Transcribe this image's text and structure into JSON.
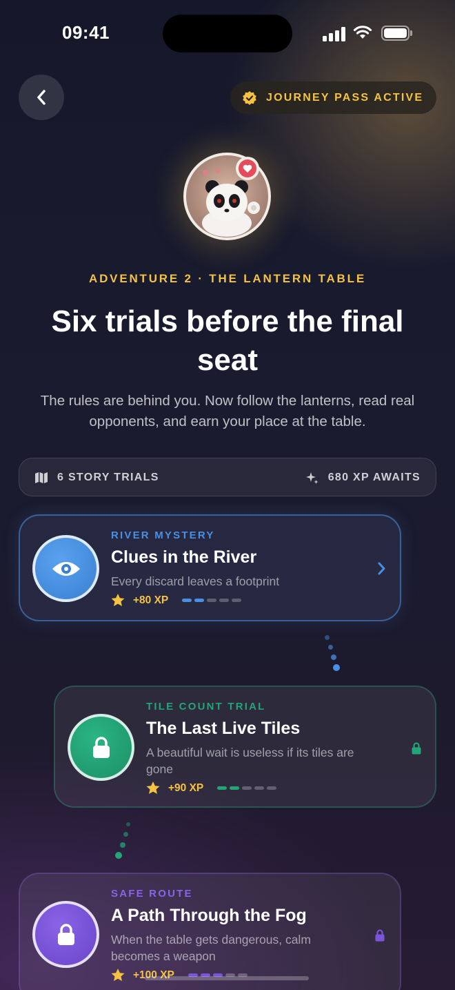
{
  "status": {
    "time": "09:41"
  },
  "header": {
    "back_icon": "chevron-left-icon",
    "pass_label": "JOURNEY PASS ACTIVE",
    "pass_icon": "verified-badge-icon"
  },
  "hero": {
    "eyebrow": "ADVENTURE 2 · THE LANTERN TABLE",
    "title": "Six trials before the final seat",
    "subtitle": "The rules are behind you. Now follow the lanterns, read real opponents, and earn your place at the table."
  },
  "stats": {
    "trials_label": "6 STORY TRIALS",
    "xp_label": "680 XP AWAITS"
  },
  "trials": [
    {
      "kicker": "RIVER MYSTERY",
      "title": "Clues in the River",
      "desc": "Every discard leaves a footprint",
      "xp": "+80 XP",
      "icon": "eye-icon",
      "state": "open",
      "accent": "#4a90e2",
      "progress": 2,
      "steps": 5
    },
    {
      "kicker": "TILE COUNT TRIAL",
      "title": "The Last Live Tiles",
      "desc": "A beautiful wait is useless if its tiles are gone",
      "xp": "+90 XP",
      "icon": "lock-icon",
      "state": "locked",
      "accent": "#22a577",
      "progress": 2,
      "steps": 5
    },
    {
      "kicker": "SAFE ROUTE",
      "title": "A Path Through the Fog",
      "desc": "When the table gets dangerous, calm becomes a weapon",
      "xp": "+100 XP",
      "icon": "lock-icon",
      "state": "locked",
      "accent": "#7b55d8",
      "progress": 3,
      "steps": 5
    }
  ],
  "colors": {
    "gold": "#f5c242",
    "blue": "#4a90e2",
    "teal": "#22a577",
    "violet": "#7b55d8"
  }
}
